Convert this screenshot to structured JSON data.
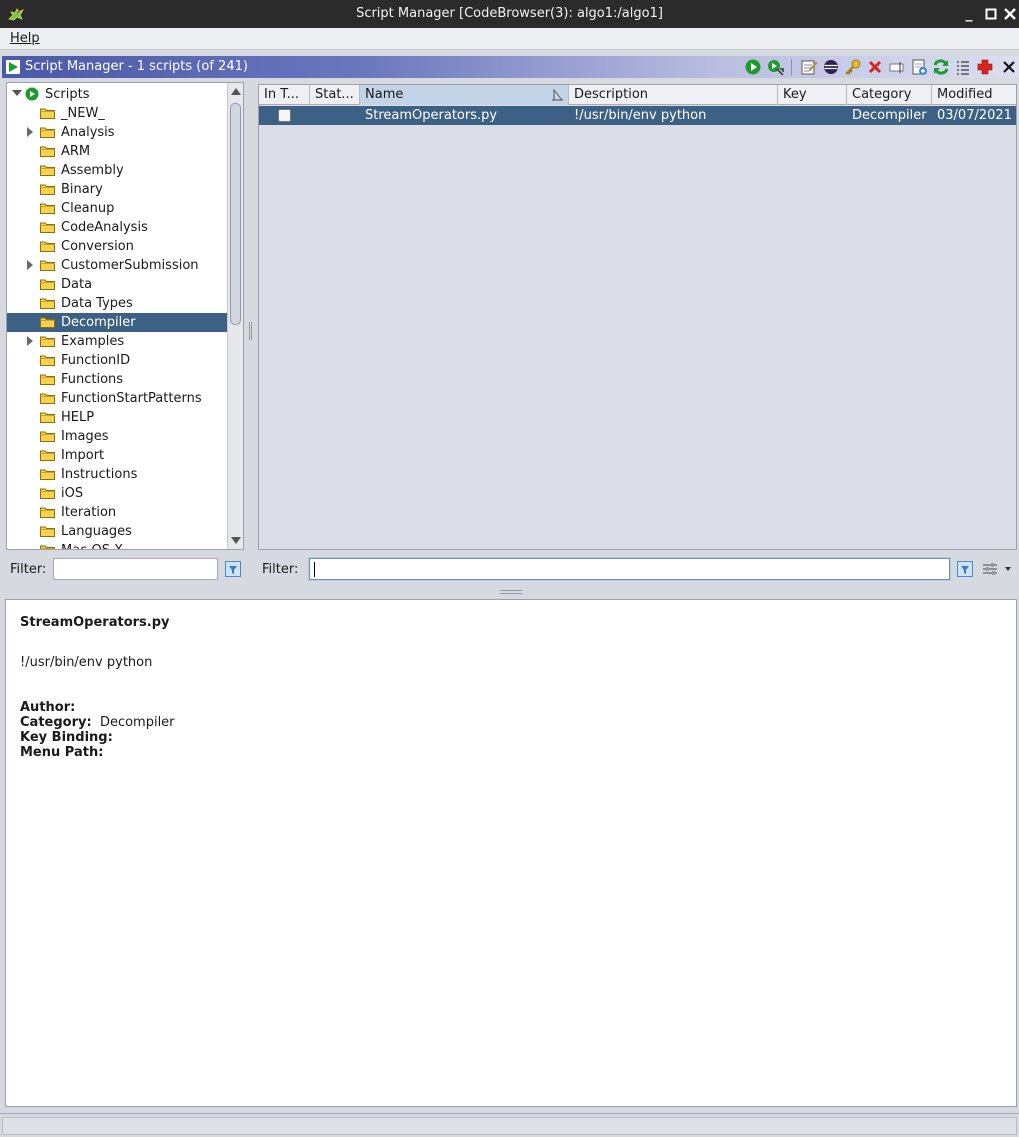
{
  "window": {
    "title": "Script Manager [CodeBrowser(3): algo1:/algo1]",
    "controls": [
      "_",
      "□",
      "✕"
    ]
  },
  "menubar": {
    "help_label": "Help"
  },
  "component": {
    "title": "Script Manager - 1 scripts  (of 241)",
    "toolbar_icons": [
      "run-script-icon",
      "run-last-script-icon",
      "edit-script-icon",
      "edit-eclipse-icon",
      "key-binding-icon",
      "delete-script-icon",
      "rename-script-icon",
      "new-script-icon",
      "refresh-icon",
      "script-directories-icon",
      "help-icon",
      "close-icon"
    ]
  },
  "tree": {
    "root_label": "Scripts",
    "items": [
      {
        "label": "_NEW_",
        "expandable": false
      },
      {
        "label": "Analysis",
        "expandable": true
      },
      {
        "label": "ARM",
        "expandable": false
      },
      {
        "label": "Assembly",
        "expandable": false
      },
      {
        "label": "Binary",
        "expandable": false
      },
      {
        "label": "Cleanup",
        "expandable": false
      },
      {
        "label": "CodeAnalysis",
        "expandable": false
      },
      {
        "label": "Conversion",
        "expandable": false
      },
      {
        "label": "CustomerSubmission",
        "expandable": true
      },
      {
        "label": "Data",
        "expandable": false
      },
      {
        "label": "Data Types",
        "expandable": false
      },
      {
        "label": "Decompiler",
        "expandable": false,
        "selected": true
      },
      {
        "label": "Examples",
        "expandable": true
      },
      {
        "label": "FunctionID",
        "expandable": false
      },
      {
        "label": "Functions",
        "expandable": false
      },
      {
        "label": "FunctionStartPatterns",
        "expandable": false
      },
      {
        "label": "HELP",
        "expandable": false
      },
      {
        "label": "Images",
        "expandable": false
      },
      {
        "label": "Import",
        "expandable": false
      },
      {
        "label": "Instructions",
        "expandable": false
      },
      {
        "label": "iOS",
        "expandable": false
      },
      {
        "label": "Iteration",
        "expandable": false
      },
      {
        "label": "Languages",
        "expandable": false
      },
      {
        "label": "Mac OS X",
        "expandable": false
      }
    ]
  },
  "left_filter": {
    "label": "Filter:",
    "value": ""
  },
  "table": {
    "columns": [
      "In T...",
      "Stat...",
      "Name",
      "Description",
      "Key",
      "Category",
      "Modified"
    ],
    "sorted_column": "Name",
    "rows": [
      {
        "in_tool": false,
        "status": "",
        "name": "StreamOperators.py",
        "description": "!/usr/bin/env python",
        "key": "",
        "category": "Decompiler",
        "modified": "03/07/2021"
      }
    ]
  },
  "right_filter": {
    "label": "Filter:",
    "value": ""
  },
  "details": {
    "name": "StreamOperators.py",
    "description": "!/usr/bin/env python",
    "author_label": "Author:",
    "author_value": "",
    "category_label": "Category:",
    "category_value": "Decompiler",
    "key_binding_label": "Key Binding:",
    "key_binding_value": "",
    "menu_path_label": "Menu Path:",
    "menu_path_value": ""
  },
  "colors": {
    "selection": "#3d6185",
    "header_gradient_start": "#4a59a8",
    "run_green": "#1f9a2e",
    "delete_red": "#d9261c"
  }
}
